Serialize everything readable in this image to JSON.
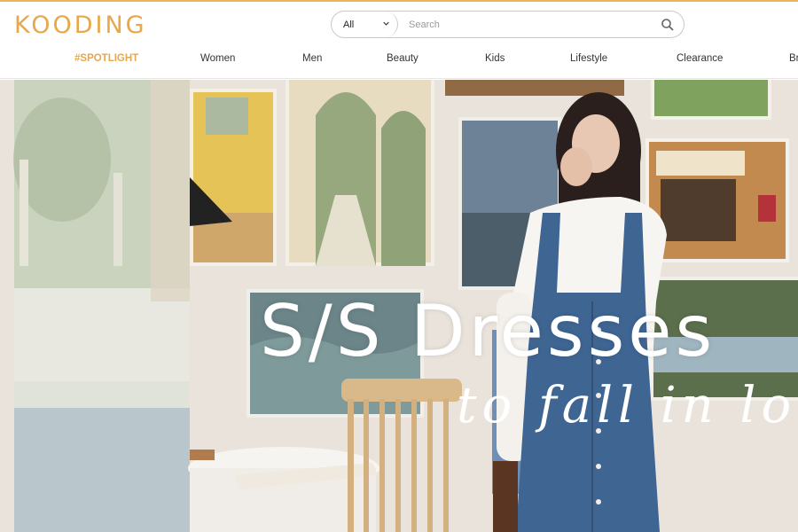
{
  "brand": {
    "logo": "KOODING",
    "accent": "#e8a74a"
  },
  "search": {
    "category": "All",
    "placeholder": "Search"
  },
  "nav": [
    "#SPOTLIGHT",
    "Women",
    "Men",
    "Beauty",
    "Kids",
    "Lifestyle",
    "Clearance",
    "Br"
  ],
  "hero": {
    "title": "S/S Dresses",
    "subtitle": "to fall in love"
  },
  "icons": {
    "search": "search-icon",
    "dropdown": "chevron-down-icon"
  }
}
